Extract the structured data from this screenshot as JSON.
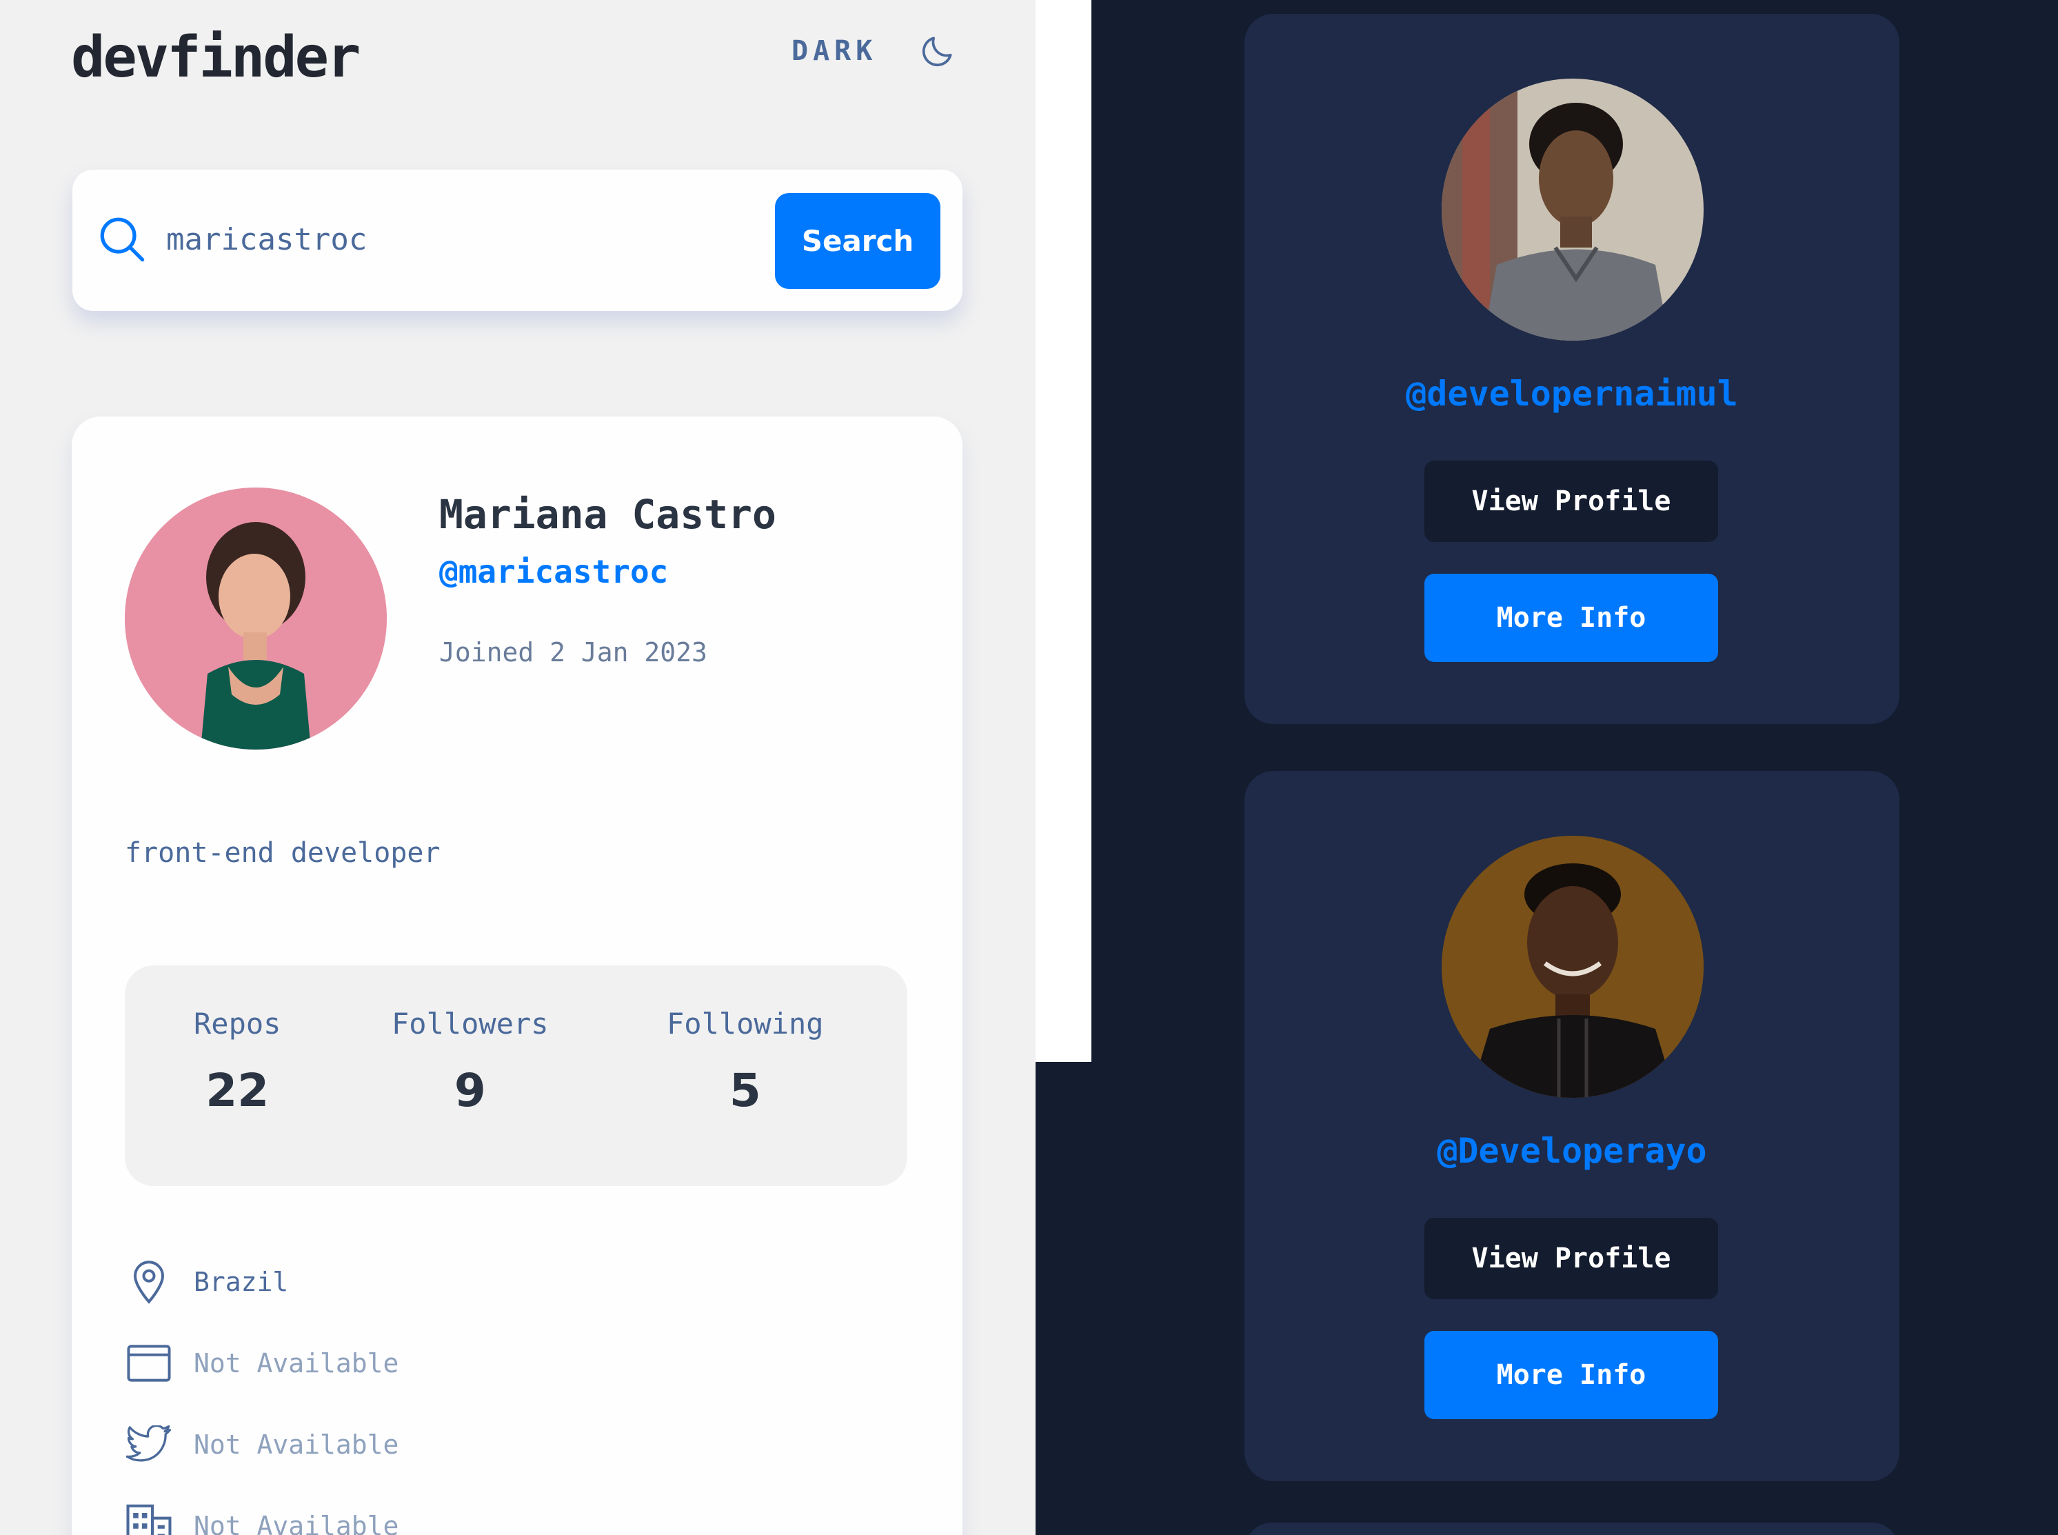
{
  "app": {
    "brand": "devfinder",
    "theme_label": "DARK"
  },
  "search": {
    "value": "maricastroc",
    "button_label": "Search"
  },
  "profile": {
    "name": "Mariana Castro",
    "login": "@maricastroc",
    "joined": "Joined 2 Jan 2023",
    "bio": "front-end developer",
    "stats": [
      {
        "label": "Repos",
        "value": "22"
      },
      {
        "label": "Followers",
        "value": "9"
      },
      {
        "label": "Following",
        "value": "5"
      }
    ],
    "links": [
      {
        "icon": "location-pin-icon",
        "text": "Brazil",
        "available": true
      },
      {
        "icon": "website-icon",
        "text": "Not Available",
        "available": false
      },
      {
        "icon": "twitter-icon",
        "text": "Not Available",
        "available": false
      },
      {
        "icon": "company-building-icon",
        "text": "Not Available",
        "available": false
      }
    ]
  },
  "developers": [
    {
      "handle": "@developernaimul",
      "view_label": "View Profile",
      "more_label": "More Info"
    },
    {
      "handle": "@Developerayo",
      "view_label": "View Profile",
      "more_label": "More Info"
    }
  ],
  "colors": {
    "accent": "#0079ff",
    "light_bg": "#f1f1f1",
    "dark_bg": "#141c2f",
    "dark_card": "#1e2a47",
    "text_dark": "#2b3442",
    "text_muted": "#4b6a9b"
  }
}
